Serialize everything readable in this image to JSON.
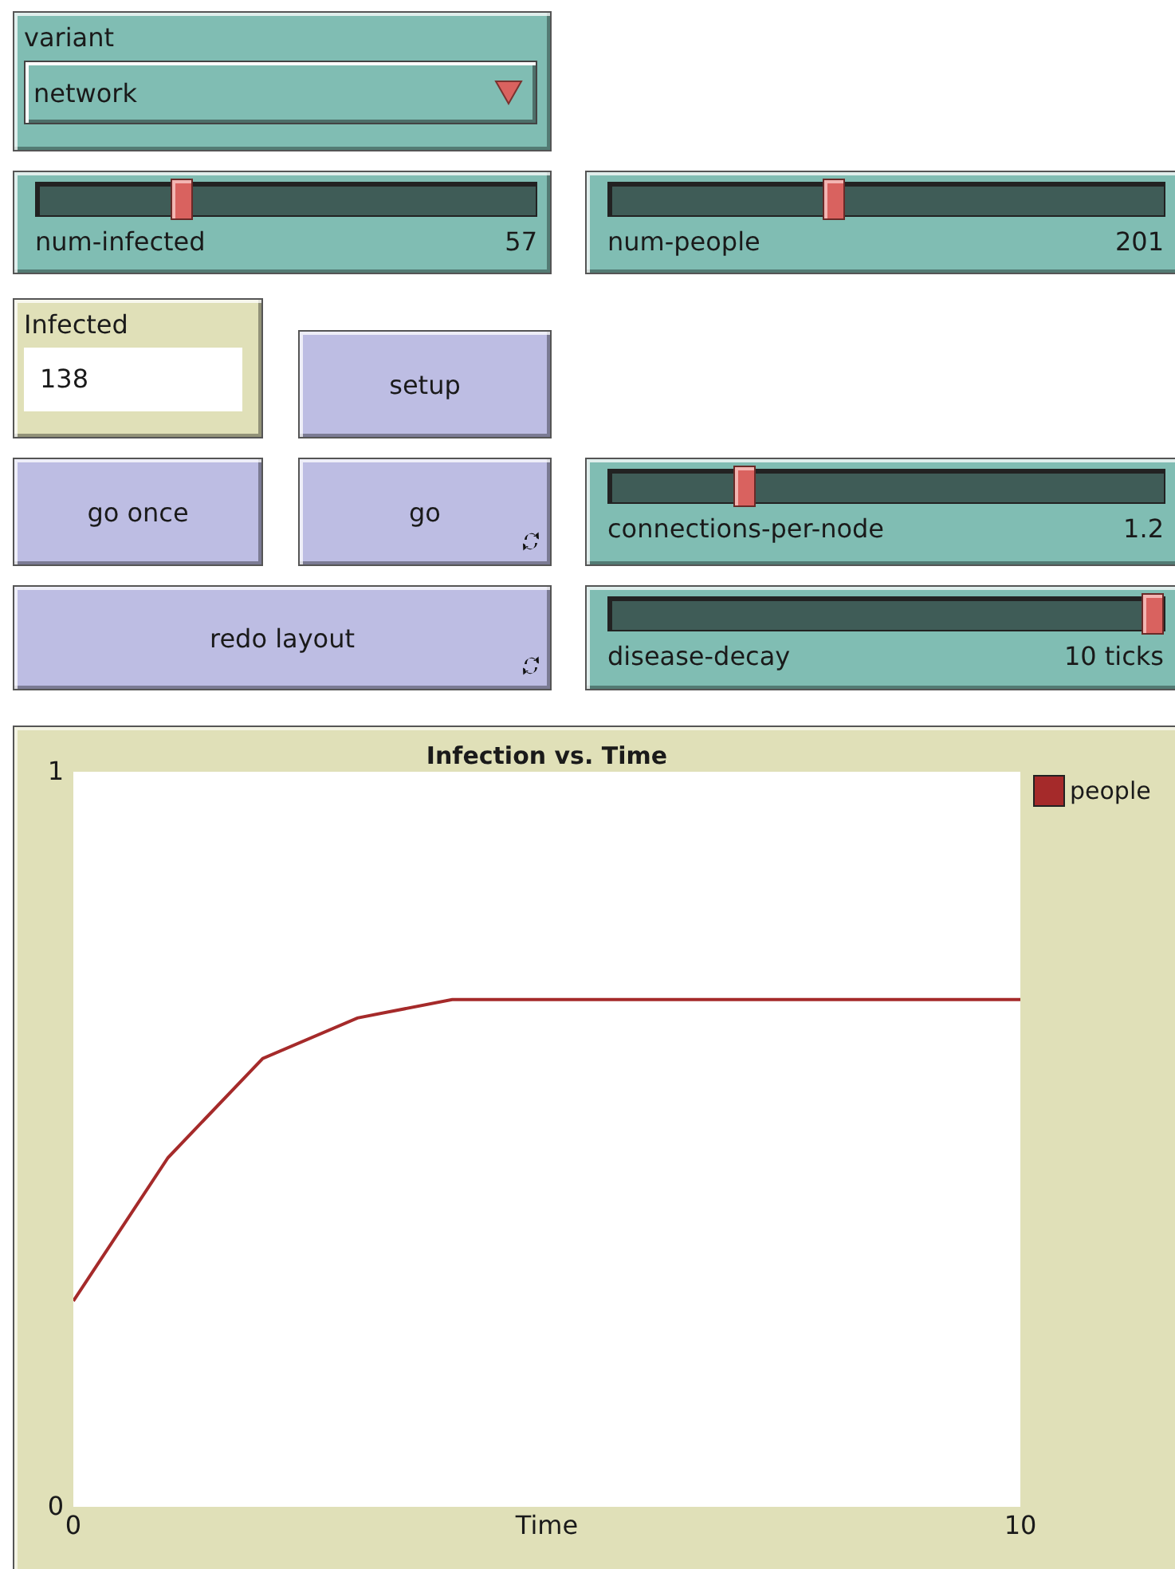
{
  "chooser": {
    "label": "variant",
    "value": "network"
  },
  "sliders": [
    {
      "name": "num-infected",
      "reading": "57",
      "level": 0.28
    },
    {
      "name": "num-people",
      "reading": "201",
      "level": 0.4
    },
    {
      "name": "connections-per-node",
      "reading": "1.2",
      "level": 0.235
    },
    {
      "name": "disease-decay",
      "reading": "10 ticks",
      "level": 1
    }
  ],
  "monitor": {
    "label": "Infected",
    "value": "138"
  },
  "buttons": [
    {
      "label": "setup",
      "forever": false
    },
    {
      "label": "go once",
      "forever": false
    },
    {
      "label": "go",
      "forever": true
    },
    {
      "label": "redo layout",
      "forever": true
    }
  ],
  "plot": {
    "chart_data": {
      "type": "line",
      "title": "Infection vs. Time",
      "xlabel": "Time",
      "x": [
        0,
        1,
        2,
        3,
        4,
        5,
        6,
        7,
        8,
        9,
        10
      ],
      "xlim": [
        0,
        10
      ],
      "ylim": [
        0,
        1
      ],
      "xticks": [
        {
          "value": 0,
          "label": "0"
        },
        {
          "value": 10,
          "label": "10"
        }
      ],
      "yticks": [
        {
          "value": 0,
          "label": "0"
        },
        {
          "value": 1,
          "label": "1"
        }
      ],
      "series": [
        {
          "name": "people",
          "color": "#a52a2a",
          "values": [
            0.28,
            0.475,
            0.61,
            0.665,
            0.69,
            0.69,
            0.69,
            0.69,
            0.69,
            0.69,
            0.69
          ]
        }
      ]
    }
  }
}
